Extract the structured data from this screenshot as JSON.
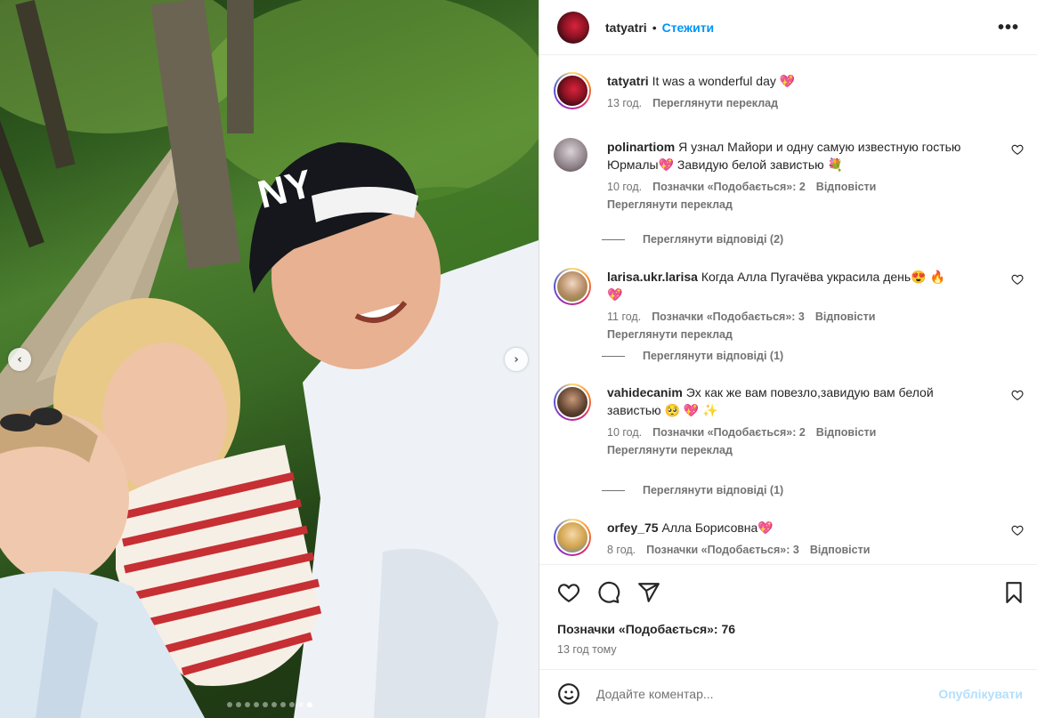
{
  "post": {
    "owner": "tatyatri",
    "follow_label": "Стежити",
    "more_label": "•••",
    "caption": {
      "user": "tatyatri",
      "text": "It was a wonderful day 💖",
      "time": "13 год.",
      "translate": "Переглянути переклад"
    }
  },
  "comments": [
    {
      "user": "polinartiom",
      "text": "Я узнал Майори и одну самую известную гостью Юрмалы💖  Завидую белой завистью 💐",
      "time": "10 год.",
      "likes": "Позначки «Подобається»: 2",
      "reply": "Відповісти",
      "translate": "Переглянути переклад",
      "replies": "Переглянути відповіді (2)"
    },
    {
      "user": "larisa.ukr.larisa",
      "text": "Когда Алла Пугачёва украсила день😍 🔥 💖",
      "time": "11 год.",
      "likes": "Позначки «Подобається»: 3",
      "reply": "Відповісти",
      "translate": "Переглянути переклад",
      "replies": "Переглянути відповіді (1)"
    },
    {
      "user": "vahidecanim",
      "text": "Эх как же вам повезло,завидую вам белой завистью 🥺 💖 ✨",
      "time": "10 год.",
      "likes": "Позначки «Подобається»: 2",
      "reply": "Відповісти",
      "translate": "Переглянути переклад",
      "replies": "Переглянути відповіді (1)"
    },
    {
      "user": "orfey_75",
      "text": "Алла Борисовна💖",
      "time": "8 год.",
      "likes": "Позначки «Подобається»: 3",
      "reply": "Відповісти"
    }
  ],
  "footer": {
    "likes": "Позначки «Подобається»: 76",
    "ago": "13 год тому",
    "comment_placeholder": "Додайте коментар...",
    "post_label": "Опублікувати"
  },
  "carousel": {
    "nav_prev": "‹",
    "nav_next": "›",
    "slide_count": 10,
    "active_slide": 10
  },
  "icons": [
    "heart-icon",
    "comment-icon",
    "share-icon",
    "bookmark-icon",
    "emoji-icon",
    "more-icon"
  ],
  "colors": {
    "link": "#0095f6",
    "muted": "#737373",
    "text": "#262626",
    "post_disabled": "#b2dffc"
  }
}
